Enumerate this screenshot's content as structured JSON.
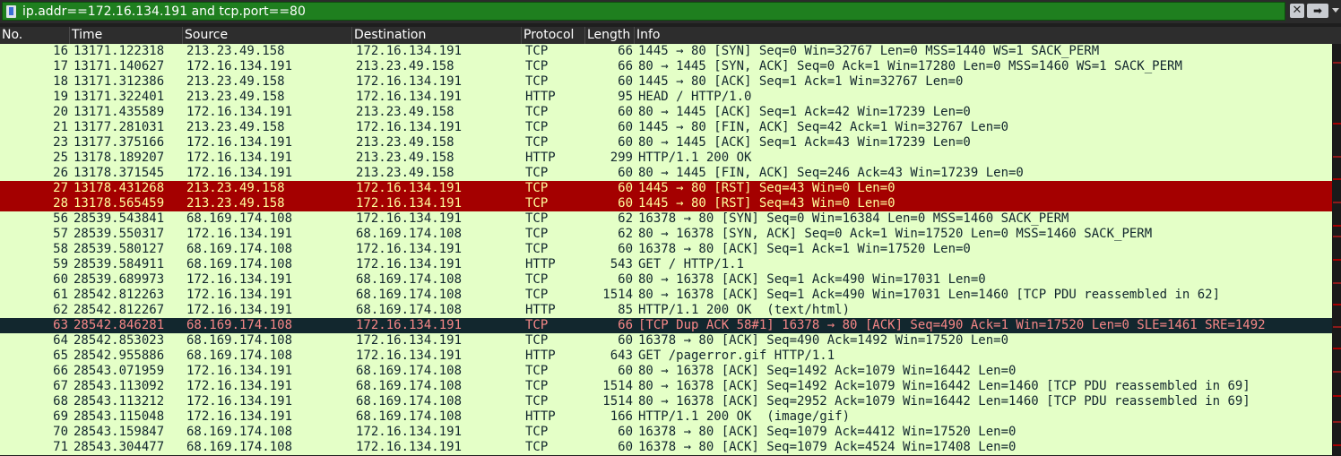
{
  "filter": {
    "icon": "bookmark-icon",
    "text": "ip.addr==172.16.134.191 and tcp.port==80",
    "clear_icon": "close-icon",
    "clear_glyph": "✕",
    "apply_icon": "arrow-right-icon",
    "apply_glyph": "➡",
    "bg_color": "#1f7f1f"
  },
  "columns": {
    "no": "No.",
    "time": "Time",
    "source": "Source",
    "destination": "Destination",
    "protocol": "Protocol",
    "length": "Length",
    "info": "Info"
  },
  "colors": {
    "row_bg": "#e4ffc7",
    "row_fg": "#12272e",
    "rst_bg": "#a40000",
    "rst_fg": "#fffc9c",
    "dup_bg": "#12272e",
    "dup_fg": "#f78787"
  },
  "packets": [
    {
      "no": "16",
      "time": "13171.122318",
      "src": "213.23.49.158",
      "dst": "172.16.134.191",
      "proto": "TCP",
      "len": "66",
      "info": "1445 → 80 [SYN] Seq=0 Win=32767 Len=0 MSS=1440 WS=1 SACK_PERM",
      "style": "normal"
    },
    {
      "no": "17",
      "time": "13171.140627",
      "src": "172.16.134.191",
      "dst": "213.23.49.158",
      "proto": "TCP",
      "len": "66",
      "info": "80 → 1445 [SYN, ACK] Seq=0 Ack=1 Win=17280 Len=0 MSS=1460 WS=1 SACK_PERM",
      "style": "normal"
    },
    {
      "no": "18",
      "time": "13171.312386",
      "src": "213.23.49.158",
      "dst": "172.16.134.191",
      "proto": "TCP",
      "len": "60",
      "info": "1445 → 80 [ACK] Seq=1 Ack=1 Win=32767 Len=0",
      "style": "normal"
    },
    {
      "no": "19",
      "time": "13171.322401",
      "src": "213.23.49.158",
      "dst": "172.16.134.191",
      "proto": "HTTP",
      "len": "95",
      "info": "HEAD / HTTP/1.0",
      "style": "normal"
    },
    {
      "no": "20",
      "time": "13171.435589",
      "src": "172.16.134.191",
      "dst": "213.23.49.158",
      "proto": "TCP",
      "len": "60",
      "info": "80 → 1445 [ACK] Seq=1 Ack=42 Win=17239 Len=0",
      "style": "normal"
    },
    {
      "no": "21",
      "time": "13177.281031",
      "src": "213.23.49.158",
      "dst": "172.16.134.191",
      "proto": "TCP",
      "len": "60",
      "info": "1445 → 80 [FIN, ACK] Seq=42 Ack=1 Win=32767 Len=0",
      "style": "normal"
    },
    {
      "no": "23",
      "time": "13177.375166",
      "src": "172.16.134.191",
      "dst": "213.23.49.158",
      "proto": "TCP",
      "len": "60",
      "info": "80 → 1445 [ACK] Seq=1 Ack=43 Win=17239 Len=0",
      "style": "normal"
    },
    {
      "no": "25",
      "time": "13178.189207",
      "src": "172.16.134.191",
      "dst": "213.23.49.158",
      "proto": "HTTP",
      "len": "299",
      "info": "HTTP/1.1 200 OK",
      "style": "normal"
    },
    {
      "no": "26",
      "time": "13178.371545",
      "src": "172.16.134.191",
      "dst": "213.23.49.158",
      "proto": "TCP",
      "len": "60",
      "info": "80 → 1445 [FIN, ACK] Seq=246 Ack=43 Win=17239 Len=0",
      "style": "normal"
    },
    {
      "no": "27",
      "time": "13178.431268",
      "src": "213.23.49.158",
      "dst": "172.16.134.191",
      "proto": "TCP",
      "len": "60",
      "info": "1445 → 80 [RST] Seq=43 Win=0 Len=0",
      "style": "rst"
    },
    {
      "no": "28",
      "time": "13178.565459",
      "src": "213.23.49.158",
      "dst": "172.16.134.191",
      "proto": "TCP",
      "len": "60",
      "info": "1445 → 80 [RST] Seq=43 Win=0 Len=0",
      "style": "rst"
    },
    {
      "no": "56",
      "time": "28539.543841",
      "src": "68.169.174.108",
      "dst": "172.16.134.191",
      "proto": "TCP",
      "len": "62",
      "info": "16378 → 80 [SYN] Seq=0 Win=16384 Len=0 MSS=1460 SACK_PERM",
      "style": "normal"
    },
    {
      "no": "57",
      "time": "28539.550317",
      "src": "172.16.134.191",
      "dst": "68.169.174.108",
      "proto": "TCP",
      "len": "62",
      "info": "80 → 16378 [SYN, ACK] Seq=0 Ack=1 Win=17520 Len=0 MSS=1460 SACK_PERM",
      "style": "normal"
    },
    {
      "no": "58",
      "time": "28539.580127",
      "src": "68.169.174.108",
      "dst": "172.16.134.191",
      "proto": "TCP",
      "len": "60",
      "info": "16378 → 80 [ACK] Seq=1 Ack=1 Win=17520 Len=0",
      "style": "normal"
    },
    {
      "no": "59",
      "time": "28539.584911",
      "src": "68.169.174.108",
      "dst": "172.16.134.191",
      "proto": "HTTP",
      "len": "543",
      "info": "GET / HTTP/1.1",
      "style": "normal"
    },
    {
      "no": "60",
      "time": "28539.689973",
      "src": "172.16.134.191",
      "dst": "68.169.174.108",
      "proto": "TCP",
      "len": "60",
      "info": "80 → 16378 [ACK] Seq=1 Ack=490 Win=17031 Len=0",
      "style": "normal"
    },
    {
      "no": "61",
      "time": "28542.812263",
      "src": "172.16.134.191",
      "dst": "68.169.174.108",
      "proto": "TCP",
      "len": "1514",
      "info": "80 → 16378 [ACK] Seq=1 Ack=490 Win=17031 Len=1460 [TCP PDU reassembled in 62]",
      "style": "normal"
    },
    {
      "no": "62",
      "time": "28542.812267",
      "src": "172.16.134.191",
      "dst": "68.169.174.108",
      "proto": "HTTP",
      "len": "85",
      "info": "HTTP/1.1 200 OK  (text/html)",
      "style": "normal"
    },
    {
      "no": "63",
      "time": "28542.846281",
      "src": "68.169.174.108",
      "dst": "172.16.134.191",
      "proto": "TCP",
      "len": "66",
      "info": "[TCP Dup ACK 58#1] 16378 → 80 [ACK] Seq=490 Ack=1 Win=17520 Len=0 SLE=1461 SRE=1492",
      "style": "dup"
    },
    {
      "no": "64",
      "time": "28542.853023",
      "src": "68.169.174.108",
      "dst": "172.16.134.191",
      "proto": "TCP",
      "len": "60",
      "info": "16378 → 80 [ACK] Seq=490 Ack=1492 Win=17520 Len=0",
      "style": "normal"
    },
    {
      "no": "65",
      "time": "28542.955886",
      "src": "68.169.174.108",
      "dst": "172.16.134.191",
      "proto": "HTTP",
      "len": "643",
      "info": "GET /pagerror.gif HTTP/1.1",
      "style": "normal"
    },
    {
      "no": "66",
      "time": "28543.071959",
      "src": "172.16.134.191",
      "dst": "68.169.174.108",
      "proto": "TCP",
      "len": "60",
      "info": "80 → 16378 [ACK] Seq=1492 Ack=1079 Win=16442 Len=0",
      "style": "normal"
    },
    {
      "no": "67",
      "time": "28543.113092",
      "src": "172.16.134.191",
      "dst": "68.169.174.108",
      "proto": "TCP",
      "len": "1514",
      "info": "80 → 16378 [ACK] Seq=1492 Ack=1079 Win=16442 Len=1460 [TCP PDU reassembled in 69]",
      "style": "normal"
    },
    {
      "no": "68",
      "time": "28543.113212",
      "src": "172.16.134.191",
      "dst": "68.169.174.108",
      "proto": "TCP",
      "len": "1514",
      "info": "80 → 16378 [ACK] Seq=2952 Ack=1079 Win=16442 Len=1460 [TCP PDU reassembled in 69]",
      "style": "normal"
    },
    {
      "no": "69",
      "time": "28543.115048",
      "src": "172.16.134.191",
      "dst": "68.169.174.108",
      "proto": "HTTP",
      "len": "166",
      "info": "HTTP/1.1 200 OK  (image/gif)",
      "style": "normal"
    },
    {
      "no": "70",
      "time": "28543.159847",
      "src": "68.169.174.108",
      "dst": "172.16.134.191",
      "proto": "TCP",
      "len": "60",
      "info": "16378 → 80 [ACK] Seq=1079 Ack=4412 Win=17520 Len=0",
      "style": "normal"
    },
    {
      "no": "71",
      "time": "28543.304477",
      "src": "68.169.174.108",
      "dst": "172.16.134.191",
      "proto": "TCP",
      "len": "60",
      "info": "16378 → 80 [ACK] Seq=1079 Ack=4524 Win=17408 Len=0",
      "style": "normal"
    }
  ]
}
